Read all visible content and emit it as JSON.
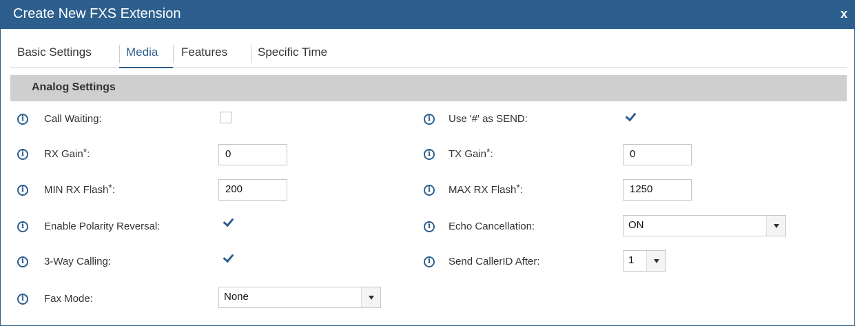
{
  "dialog": {
    "title": "Create New FXS Extension",
    "close_label": "x"
  },
  "tabs": [
    {
      "label": "Basic Settings",
      "active": false
    },
    {
      "label": "Media",
      "active": true
    },
    {
      "label": "Features",
      "active": false
    },
    {
      "label": "Specific Time",
      "active": false
    }
  ],
  "section": {
    "title": "Analog Settings"
  },
  "fields": {
    "call_waiting": {
      "label": "Call Waiting:",
      "checked": false
    },
    "use_hash_as_send": {
      "label": "Use '#' as SEND:",
      "checked": true
    },
    "rx_gain": {
      "label": "RX Gain",
      "required": "*",
      "colon": ":",
      "value": "0"
    },
    "tx_gain": {
      "label": "TX Gain",
      "required": "*",
      "colon": ":",
      "value": "0"
    },
    "min_rx_flash": {
      "label": "MIN RX Flash",
      "required": "*",
      "colon": ":",
      "value": "200"
    },
    "max_rx_flash": {
      "label": "MAX RX Flash",
      "required": "*",
      "colon": ":",
      "value": "1250"
    },
    "enable_polarity_reversal": {
      "label": "Enable Polarity Reversal:",
      "checked": true
    },
    "echo_cancellation": {
      "label": "Echo Cancellation:",
      "value": "ON"
    },
    "three_way_calling": {
      "label": "3-Way Calling:",
      "checked": true
    },
    "send_callerid_after": {
      "label": "Send CallerID After:",
      "value": "1"
    },
    "fax_mode": {
      "label": "Fax Mode:",
      "value": "None"
    }
  },
  "colors": {
    "title_bar": "#2c5f8e",
    "accent": "#2c5f8e",
    "section_header": "#cfcfcf"
  }
}
